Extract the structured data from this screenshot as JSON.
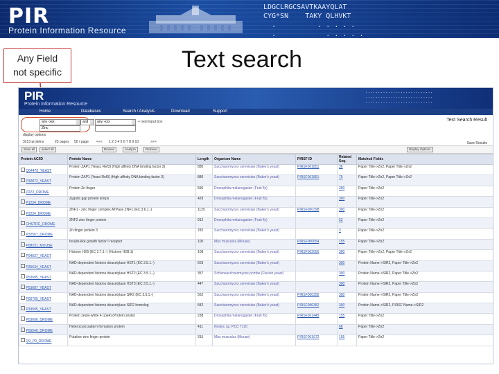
{
  "banner": {
    "logo": "PIR",
    "subtitle": "Protein Information Resource",
    "code": "LDGCLRGCSAVTKAAYQLAT\nCYG*SN    TAKY QLHVKT\n  .          . . . . .\n  .            . . . . ."
  },
  "callout": {
    "line1": "Any Field",
    "line2": "not specific"
  },
  "slide_title": "Text search",
  "app": {
    "logo": "PIR",
    "subtitle": "Protein Information Resource",
    "mini_code": "...........................\n...........................\n...........................",
    "nav": [
      "Home",
      "Databases",
      "Search / Analysis",
      "Download",
      "Support"
    ],
    "search": {
      "field1": "any -xxx",
      "op": "and",
      "field2": "any -xxx",
      "value": "Zinc",
      "add_label": "+ next input box",
      "display_label": "display options",
      "field3": "any -xxx",
      "field4": "any -xxx"
    },
    "result_title": "Text Search Result",
    "save_results": "Save Results",
    "pager": [
      "3213 proteins",
      "25 pages",
      "50 / page",
      "<<<",
      "1 2 3 4 5 6 7 8 9 10",
      ">>>"
    ],
    "toolbar": [
      "show all",
      "select all",
      "Browse",
      "Analyze",
      "Retrieve",
      "Display Options"
    ],
    "columns": [
      "Protein AC/ID",
      "Protein Name",
      "Length",
      "Organism Name",
      "PIRSF ID",
      "Related Seq.",
      "Matched Fields"
    ],
    "rows": [
      [
        "Q04470_YEAST",
        "Protein ZAP1 (Yeast, Ref3) (High affinity DNA binding factor 3)",
        "880",
        "Saccharomyces cerevisiae (Baker's yeast)",
        "PIRSF001851",
        "36",
        "Paper Title->Zn2, Paper Title->Zn2"
      ],
      [
        "P32872_YEAST",
        "Protein ZAP1 (Yeast Ref3) (High affinity DNA binding factor 3)",
        "880",
        "Saccharomyces cerevisiae (Baker's yeast)",
        "PIRSF001851",
        "75",
        "Paper Title->Zn2, Paper Title->Zn2"
      ],
      [
        "P2Z2_DROME",
        "Protein Zn-finger",
        "596",
        "Drosophila melanogaster (Fruit fly)",
        "",
        "300",
        "Paper Title->Zn2"
      ],
      [
        "P1234_DROME",
        "Zygotic gap protein knirps",
        "429",
        "Drosophila melanogaster (Fruit fly)",
        "",
        "300",
        "Paper Title->Zn2"
      ],
      [
        "P3234_DROME",
        "ZNF1 - zinc finger complex ATPase ZNF1 (EC 3.6.1.-)",
        "1125",
        "Saccharomyces cerevisiae (Baker's yeast)",
        "PIRSF000398",
        "300",
        "Paper Title->Zn2"
      ],
      [
        "CHSTRC_DROME",
        "ZNF2 zinc finger protein",
        "912",
        "Drosophila melanogaster (Fruit fly)",
        "",
        "62",
        "Paper Title->Zn2"
      ],
      [
        "P32567_DROME",
        "Zn-finger protein 3",
        "782",
        "Saccharomyces cerevisiae (Baker's yeast)",
        "",
        "3",
        "Paper Title->Zn2"
      ],
      [
        "P08231_MOUSE",
        "Insulin-like growth factor I receptor",
        "100",
        "Mus musculus (Mouse)",
        "PIRSF000654",
        "155",
        "Paper Title->Zn2"
      ],
      [
        "P04037_YEAST",
        "Histone H2B (EC 2.7.1.-) (Histone H2B.1)",
        "108",
        "Saccharomyces cerevisiae (Baker's yeast)",
        "PIRSF002050",
        "300",
        "Paper Title->Zn2, Paper Title->Zn2"
      ],
      [
        "P25634_YEAST",
        "NAD-dependent histone deacetylase HST1 (EC 3.5.1.-)",
        "503",
        "Saccharomyces cerevisiae (Baker's yeast)",
        "",
        "300",
        "Protein Name->SIR2, Paper Title->Zn2"
      ],
      [
        "P53685_YEAST",
        "NAD-dependent histone deacetylase HST2 (EC 3.5.1.-)",
        "357",
        "Schizosaccharomyces pombe (Fission yeast)",
        "",
        "300",
        "Protein Name->SIR2, Paper Title->Zn2"
      ],
      [
        "P53687_YEAST",
        "NAD-dependent histone deacetylase HST3 (EC 3.5.1.-)",
        "447",
        "Saccharomyces cerevisiae (Baker's yeast)",
        "",
        "300",
        "Protein Name->SIR2, Paper Title->Zn2"
      ],
      [
        "P06700_YEAST",
        "NAD-dependent histone deacetylase SIR2 (EC 3.5.1.-)",
        "562",
        "Saccharomyces cerevisiae (Baker's yeast)",
        "PIRSF000356",
        "300",
        "Protein Name->SIR2, Paper Title->Zn2"
      ],
      [
        "P33505_YEAST",
        "NAD-dependent histone deacetylase SIR2 homolog",
        "582",
        "Saccharomyces cerevisiae (Baker's yeast)",
        "PIRSF000352",
        "300",
        "Protein Name->SIR2, PIRSF Name->SIR2"
      ],
      [
        "P03606_DROME",
        "Protein zeste-white 4 (Zw4) (Protein zeste)",
        "238",
        "Drosophila melanogaster (Fruit fly)",
        "PIRSF001445",
        "155",
        "Paper Title->Zn2"
      ],
      [
        "P06540_DROME",
        "Heterocyst pattern formation protein",
        "411",
        "Nostoc sp. PCC 7120",
        "",
        "68",
        "Paper Title->Zn2"
      ],
      [
        "Q9_P0_DROME",
        "Putative zinc finger protein",
        "315",
        "Mus musculus (Mouse)",
        "PIRSF001672",
        "155",
        "Paper Title->Zn2"
      ]
    ]
  }
}
